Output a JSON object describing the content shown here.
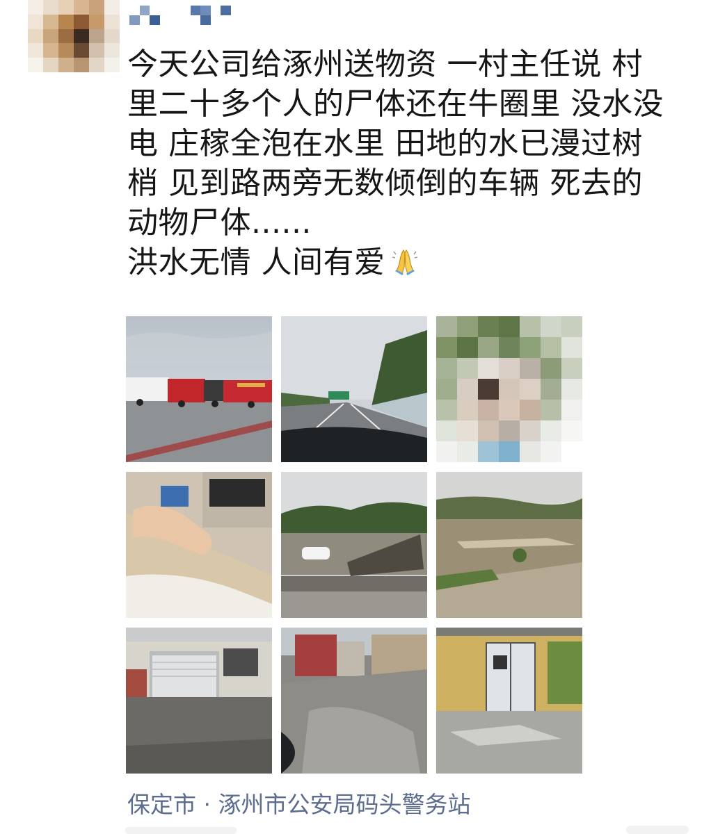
{
  "post": {
    "username": "",
    "text_lines": [
      "今天公司给涿州送物资 一村主任说 村",
      "里二十多个人的尸体还在牛圈里 没水没",
      "电 庄稼全泡在水里 田地的水已漫过树",
      "梢 见到路两旁无数倾倒的车辆 死去的",
      "动物尸体......",
      "洪水无情 人间有爱"
    ],
    "emoji": "folded-hands",
    "location": "保定市 · 涿州市公安局码头警务站"
  },
  "photos": [
    {
      "name": "photo-trucks-parked",
      "subject": "red cargo trucks parked on pavement"
    },
    {
      "name": "photo-highway-windshield",
      "subject": "highway viewed through windshield"
    },
    {
      "name": "photo-person-pixelated",
      "subject": "pixelated face of a person"
    },
    {
      "name": "photo-car-interior",
      "subject": "arm resting inside a car"
    },
    {
      "name": "photo-flooded-road-car",
      "subject": "damaged road with white car and debris"
    },
    {
      "name": "photo-muddy-field",
      "subject": "muddy field after flooding"
    },
    {
      "name": "photo-damaged-shop",
      "subject": "damaged shop with shutter"
    },
    {
      "name": "photo-mud-street",
      "subject": "mud covered street with red gate"
    },
    {
      "name": "photo-broken-building",
      "subject": "yellow building with broken windows"
    }
  ],
  "colors": {
    "text": "#161616",
    "location": "#5b6c8f",
    "background": "#ffffff"
  }
}
